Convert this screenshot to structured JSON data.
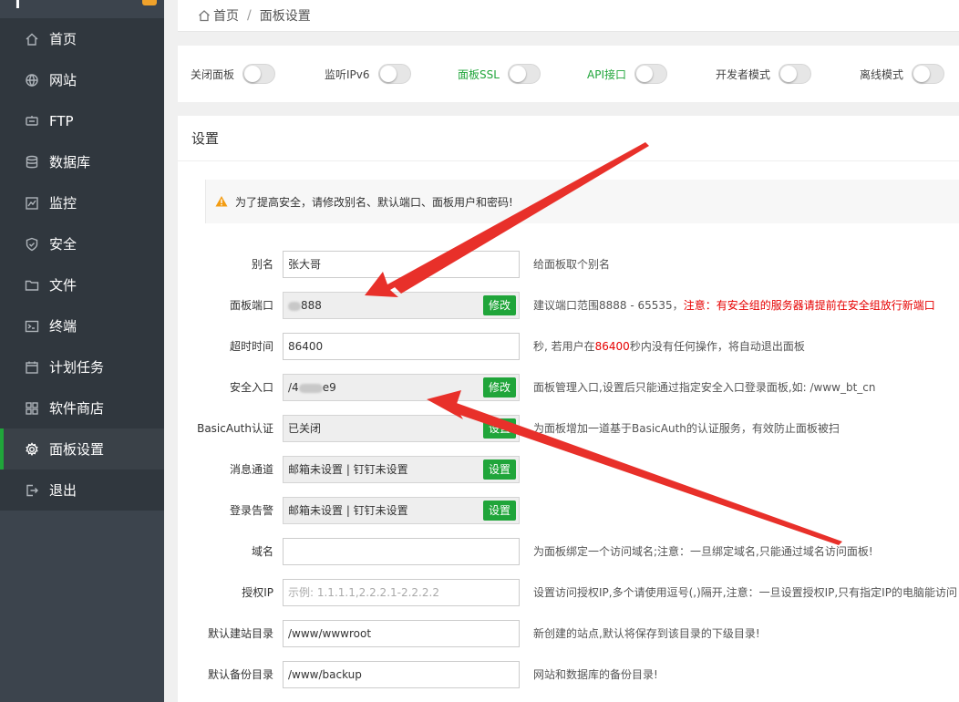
{
  "sidebar": {
    "items": [
      {
        "label": "首页",
        "icon": "home-icon"
      },
      {
        "label": "网站",
        "icon": "globe-icon"
      },
      {
        "label": "FTP",
        "icon": "ftp-icon"
      },
      {
        "label": "数据库",
        "icon": "database-icon"
      },
      {
        "label": "监控",
        "icon": "monitor-icon"
      },
      {
        "label": "安全",
        "icon": "shield-icon"
      },
      {
        "label": "文件",
        "icon": "folder-icon"
      },
      {
        "label": "终端",
        "icon": "terminal-icon"
      },
      {
        "label": "计划任务",
        "icon": "calendar-icon"
      },
      {
        "label": "软件商店",
        "icon": "grid-icon"
      },
      {
        "label": "面板设置",
        "icon": "gear-icon",
        "active": true
      },
      {
        "label": "退出",
        "icon": "logout-icon"
      }
    ]
  },
  "breadcrumb": {
    "home": "首页",
    "sep": "/",
    "current": "面板设置"
  },
  "toggles": [
    {
      "label": "关闭面板",
      "on": false
    },
    {
      "label": "监听IPv6",
      "on": false
    },
    {
      "label": "面板SSL",
      "on": false,
      "color": "#20a53a"
    },
    {
      "label": "API接口",
      "on": false,
      "color": "#20a53a"
    },
    {
      "label": "开发者模式",
      "on": false
    },
    {
      "label": "离线模式",
      "on": false
    }
  ],
  "panel": {
    "title": "设置",
    "warning": "为了提高安全，请修改别名、默认端口、面板用户和密码!"
  },
  "form": {
    "alias": {
      "label": "别名",
      "value": "张大哥",
      "hint": "给面板取个别名"
    },
    "port": {
      "label": "面板端口",
      "value": "888",
      "button": "修改",
      "hint": "建议端口范围8888 - 65535，",
      "hint_red": "注意：有安全组的服务器请提前在安全组放行新端口"
    },
    "timeout": {
      "label": "超时时间",
      "value": "86400",
      "hint_a": "秒, 若用户在",
      "hint_num": "86400",
      "hint_b": "秒内没有任何操作，将自动退出面板"
    },
    "entry": {
      "label": "安全入口",
      "value_a": "/4",
      "value_b": "e9",
      "button": "修改",
      "hint": "面板管理入口,设置后只能通过指定安全入口登录面板,如: /www_bt_cn"
    },
    "basicauth": {
      "label": "BasicAuth认证",
      "value": "已关闭",
      "button": "设置",
      "hint": "为面板增加一道基于BasicAuth的认证服务，有效防止面板被扫"
    },
    "msg": {
      "label": "消息通道",
      "value": "邮箱未设置 | 钉钉未设置",
      "button": "设置"
    },
    "alarm": {
      "label": "登录告警",
      "value": "邮箱未设置 | 钉钉未设置",
      "button": "设置"
    },
    "domain": {
      "label": "域名",
      "value": "",
      "hint": "为面板绑定一个访问域名;注意：一旦绑定域名,只能通过域名访问面板!"
    },
    "ip": {
      "label": "授权IP",
      "placeholder": "示例: 1.1.1.1,2.2.2.1-2.2.2.2",
      "hint": "设置访问授权IP,多个请使用逗号(,)隔开,注意：一旦设置授权IP,只有指定IP的电脑能访问"
    },
    "siteDir": {
      "label": "默认建站目录",
      "value": "/www/wwwroot",
      "hint": "新创建的站点,默认将保存到该目录的下级目录!"
    },
    "backupDir": {
      "label": "默认备份目录",
      "value": "/www/backup",
      "hint": "网站和数据库的备份目录!"
    }
  },
  "colors": {
    "accent": "#20a53a",
    "annotation": "#e8302a",
    "sidebar": "#30373e"
  }
}
